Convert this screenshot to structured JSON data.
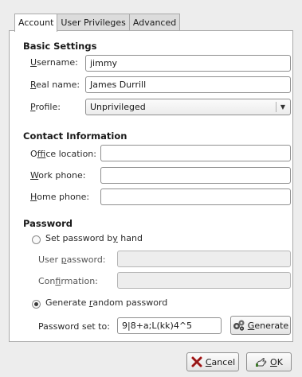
{
  "tabs": [
    {
      "label": "Account",
      "active": true
    },
    {
      "label": "User Privileges",
      "active": false
    },
    {
      "label": "Advanced",
      "active": false
    }
  ],
  "basic": {
    "title": "Basic Settings",
    "username_label": "Username:",
    "username_value": "jimmy",
    "realname_label": "Real name:",
    "realname_value": "James Durrill",
    "profile_label": "Profile:",
    "profile_value": "Unprivileged"
  },
  "contact": {
    "title": "Contact Information",
    "office_label": "Office location:",
    "office_value": "",
    "work_label": "Work phone:",
    "work_value": "",
    "home_label": "Home phone:",
    "home_value": ""
  },
  "password": {
    "title": "Password",
    "set_by_hand_label": "Set password by hand",
    "set_by_hand_checked": false,
    "user_password_label": "User password:",
    "confirmation_label": "Confirmation:",
    "generate_label": "Generate random password",
    "generate_checked": true,
    "set_to_label": "Password set to:",
    "set_to_value": "9|8+a;L(kk)4^5",
    "generate_button": "Generate"
  },
  "buttons": {
    "cancel": "Cancel",
    "ok": "OK"
  },
  "icons": {
    "generate": "gears-icon",
    "cancel": "x-cancel-icon",
    "ok": "ok-hand-icon"
  }
}
